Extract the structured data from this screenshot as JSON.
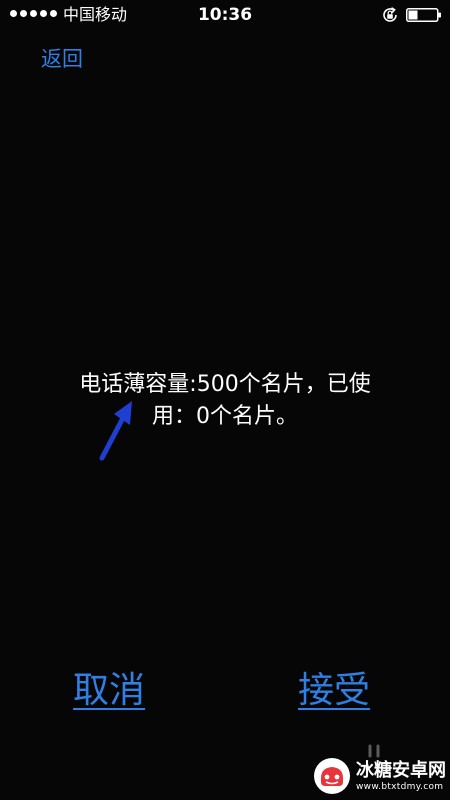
{
  "status_bar": {
    "carrier": "中国移动",
    "time": "10:36",
    "signal_bars": 5,
    "icons": [
      "signal-dots-icon",
      "rotation-lock-icon",
      "battery-icon"
    ]
  },
  "nav": {
    "back_label": "返回"
  },
  "message": {
    "line1": "电话薄容量:500个名片，已使",
    "line2": "用：0个名片。"
  },
  "annotation": {
    "icon": "arrow-icon",
    "color": "#1f3fd0"
  },
  "actions": {
    "cancel_label": "取消",
    "accept_label": "接受"
  },
  "watermark": {
    "title": "冰糖安卓网",
    "url": "www.btxtdmy.com"
  },
  "colors": {
    "background": "#060606",
    "link": "#2f7fe4",
    "text": "#ffffff"
  }
}
